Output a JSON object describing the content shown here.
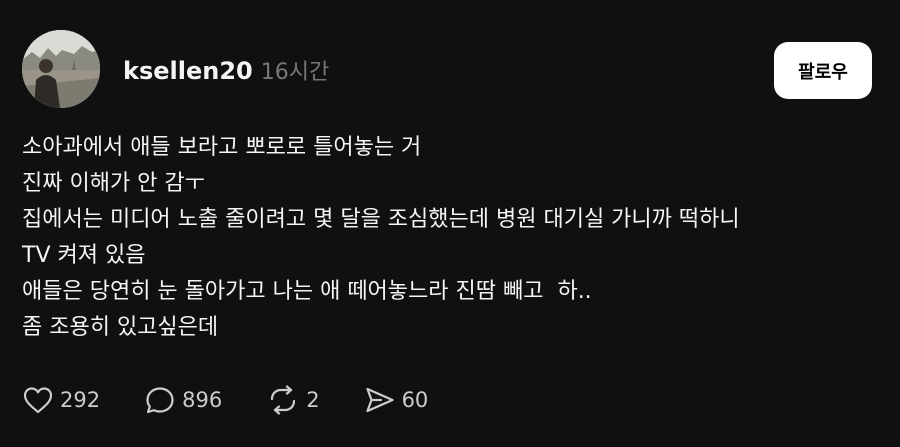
{
  "post": {
    "author": {
      "username": "ksellen20",
      "timestamp": "16시간"
    },
    "follow_label": "팔로우",
    "body_lines": [
      "소아과에서 애들 보라고 뽀로로 틀어놓는 거",
      "진짜 이해가 안 감ㅜ",
      "집에서는 미디어 노출 줄이려고 몇 달을 조심했는데 병원 대기실 가니까 떡하니",
      "TV 켜져 있음",
      "애들은 당연히 눈 돌아가고 나는 애 떼어놓느라 진땀 빼고  하..",
      "좀 조용히 있고싶은데"
    ],
    "actions": {
      "like_count": "292",
      "comment_count": "896",
      "repost_count": "2",
      "share_count": "60"
    },
    "icons": [
      "avatar",
      "heart-icon",
      "comment-icon",
      "repost-icon",
      "share-icon"
    ]
  }
}
